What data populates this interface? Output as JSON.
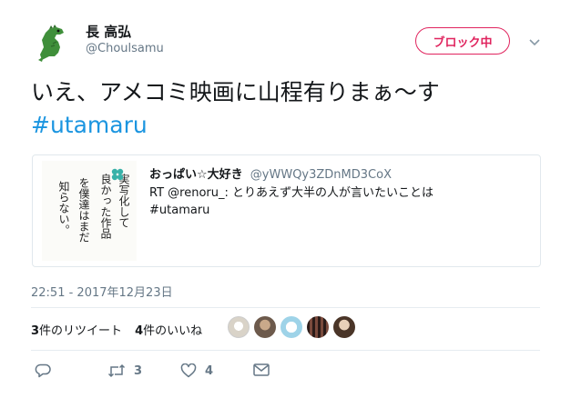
{
  "author": {
    "display_name": "長 高弘",
    "handle": "@Choulsamu",
    "avatar": "dinosaur-icon"
  },
  "header": {
    "block_button_label": "ブロック中",
    "menu_icon": "chevron-down-icon"
  },
  "tweet": {
    "text": "いえ、アメコミ映画に山程有りまぁ～す",
    "hashtag": "#utamaru",
    "timestamp": "22:51 - 2017年12月23日"
  },
  "quote": {
    "display_name": "おっぱい☆大好き",
    "handle": "@yWWQy3ZDnMD3CoX",
    "line1": "RT @renoru_: とりあえず大半の人が言いたいことは",
    "line2": "#utamaru",
    "image_columns": [
      "実写化して",
      "良かった作品",
      "を僕達はまだ",
      "知らない。"
    ]
  },
  "stats": {
    "retweets_count": "3",
    "retweets_label": "件のリツイート",
    "likes_count": "4",
    "likes_label": "件のいいね"
  },
  "likers": [
    "avatar-1",
    "avatar-2",
    "avatar-3",
    "avatar-4",
    "avatar-5"
  ],
  "actions": {
    "reply_icon": "reply-icon",
    "retweet_icon": "retweet-icon",
    "retweet_count": "3",
    "like_icon": "heart-icon",
    "like_count": "4",
    "dm_icon": "envelope-icon"
  },
  "colors": {
    "accent": "#1b95e0",
    "block": "#e0245e",
    "muted": "#657786",
    "text": "#14171a",
    "border": "#e1e8ed"
  }
}
